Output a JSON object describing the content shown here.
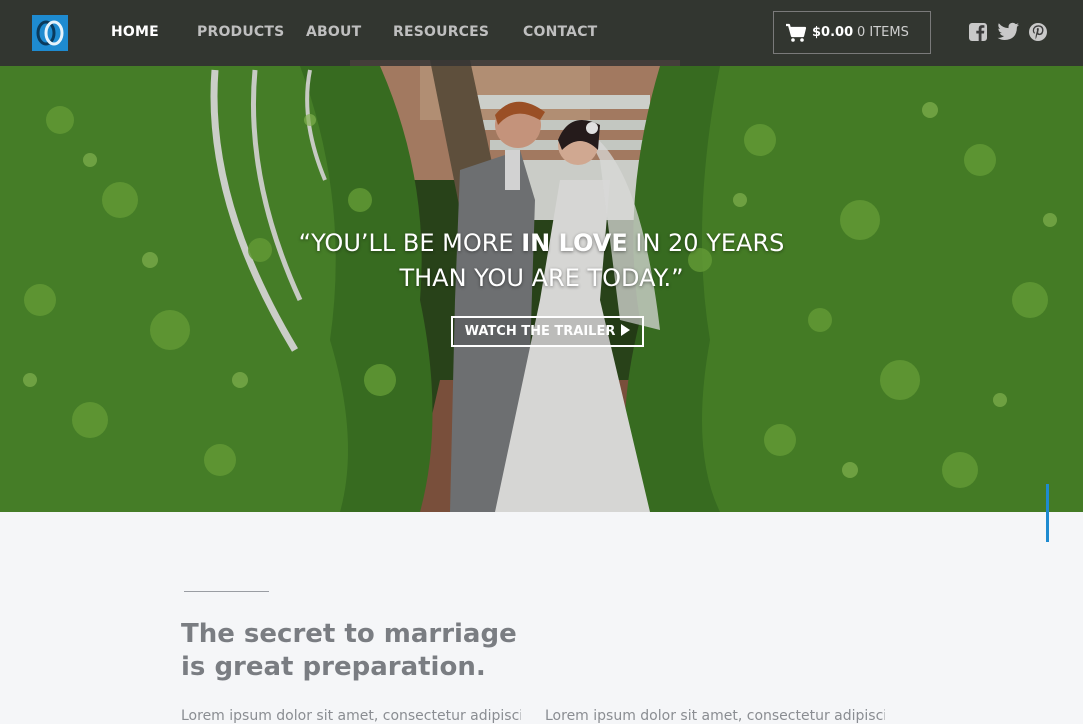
{
  "brand": {
    "color": "#1e8bd0",
    "logo": "interlocking-rings-logo"
  },
  "nav": {
    "links": [
      {
        "label": "HOME",
        "active": true
      },
      {
        "label": "PRODUCTS",
        "active": false
      },
      {
        "label": "ABOUT",
        "active": false
      },
      {
        "label": "RESOURCES",
        "active": false
      },
      {
        "label": "CONTACT",
        "active": false
      }
    ],
    "cart": {
      "icon": "cart-icon",
      "total": "$0.00",
      "items": "0 ITEMS"
    },
    "social": [
      "facebook-icon",
      "twitter-icon",
      "pinterest-icon"
    ]
  },
  "hero": {
    "image": "wedding couple under white garden arbor with green ivy",
    "quote_prefix": "“YOU’LL BE MORE ",
    "quote_emphasis": "IN LOVE",
    "quote_line1_suffix": " IN 20 YEARS",
    "quote_line2": "THAN YOU ARE TODAY.”",
    "cta_label": "WATCH THE TRAILER",
    "cta_icon": "play-icon"
  },
  "content": {
    "headline_line1": "The secret to marriage",
    "headline_line2": "is great preparation.",
    "col1_text": "Lorem ipsum dolor sit amet, consectetur adipiscing",
    "col2_text": "Lorem ipsum dolor sit amet, consectetur adipiscing"
  }
}
